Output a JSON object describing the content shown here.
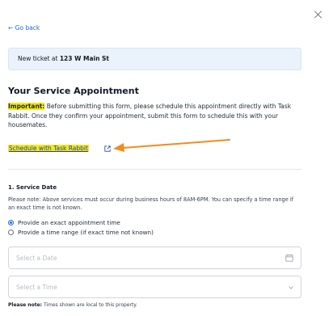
{
  "modal": {
    "close_label": "×"
  },
  "nav": {
    "go_back": "← Go back"
  },
  "ticket": {
    "prefix": "New ticket at ",
    "address": "123 W Main St"
  },
  "appointment": {
    "title": "Your Service Appointment",
    "important_label": "Important:",
    "important_text": " Before submitting this form, please schedule this appointment directly with Task Rabbit. Once they confirm your appointment, submit this form to schedule this with your housemates.",
    "schedule_link": "Schedule with Task Rabbit",
    "highlight_color": "#f5ea14",
    "arrow_color": "#f28c1e"
  },
  "service_date": {
    "heading": "1. Service Date",
    "note": "Please note: Above services must occur during business hours of 8AM-6PM. You can specify a time range if an exact time is not known.",
    "options": [
      {
        "label": "Provide an exact appointment time",
        "selected": true
      },
      {
        "label": "Provide a time range (if exact time not known)",
        "selected": false
      }
    ],
    "date_placeholder": "Select a Date",
    "time_placeholder": "Select a Time",
    "footnote_label": "Please note:",
    "footnote_text": " Times shown are local to this property."
  },
  "icons": {
    "close": "close-icon",
    "external_link": "external-link-icon",
    "calendar": "calendar-icon",
    "dropdown": "chevron-down-icon",
    "pointer_arrow": "arrow-icon"
  }
}
